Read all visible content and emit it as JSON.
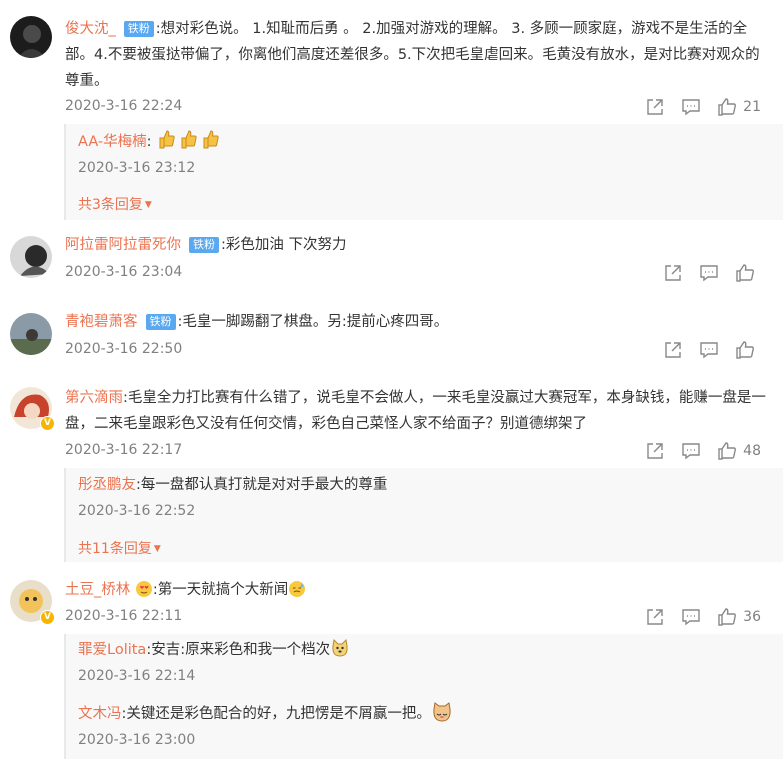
{
  "comments": [
    {
      "user": "俊大沈_",
      "badge": "铁粉",
      "text": ":想对彩色说。 1.知耻而后勇 。 2.加强对游戏的理解。 3. 多顾一顾家庭，游戏不是生活的全部。4.不要被蛋挞带偏了，你离他们高度还差很多。5.下次把毛皇虐回来。毛黄没有放水，是对比赛对观众的尊重。",
      "time": "2020-3-16 22:24",
      "likes": "21",
      "replies": [
        {
          "user": "AA-华梅楠",
          "text": ":",
          "time": "2020-3-16 23:12",
          "emoji": "thumbs-up-x3"
        }
      ],
      "more": "共3条回复"
    },
    {
      "user": "阿拉雷阿拉雷死你",
      "badge": "铁粉",
      "text": ":彩色加油 下次努力",
      "time": "2020-3-16 23:04",
      "likes": ""
    },
    {
      "user": "青袍碧萧客",
      "badge": "铁粉",
      "text": ":毛皇一脚踢翻了棋盘。另:提前心疼四哥。",
      "time": "2020-3-16 22:50",
      "likes": ""
    },
    {
      "user": "第六滴雨",
      "text": ":毛皇全力打比赛有什么错了，说毛皇不会做人，一来毛皇没赢过大赛冠军，本身缺钱，能赚一盘是一盘，二来毛皇跟彩色又没有任何交情，彩色自己菜怪人家不给面子？别道德绑架了",
      "time": "2020-3-16 22:17",
      "likes": "48",
      "replies": [
        {
          "user": "彤丞鹏友",
          "text": ":每一盘都认真打就是对对手最大的尊重",
          "time": "2020-3-16 22:52"
        }
      ],
      "more": "共11条回复"
    },
    {
      "user": "土豆_桥林",
      "text": ":第一天就搞个大新闻",
      "time": "2020-3-16 22:11",
      "likes": "36",
      "replies": [
        {
          "user": "罪爱Lolita",
          "text": ":安吉:原来彩色和我一个档次",
          "time": "2020-3-16 22:14"
        },
        {
          "user": "文木冯",
          "text": ":关键还是彩色配合的好，九把愣是不屑赢一把。",
          "time": "2020-3-16 23:00"
        }
      ]
    }
  ],
  "colors": {
    "username": "#eb7350",
    "badge": "#5aa9f0",
    "time": "#808080",
    "verified": "#f7b500"
  },
  "icons": [
    "share-icon",
    "comment-icon",
    "like-icon"
  ]
}
